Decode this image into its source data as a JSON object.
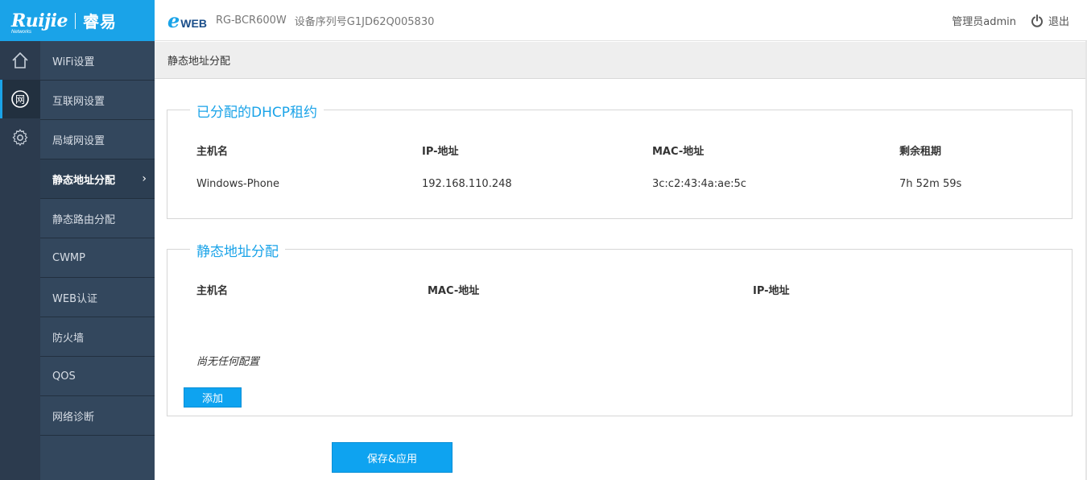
{
  "brand": {
    "logo_text": "Ruijie",
    "logo_sub": "Networks",
    "logo_cn": "睿易",
    "product_e": "e",
    "product_web": "WEB",
    "model": "RG-BCR600W",
    "serial": "设备序列号G1JD62Q005830"
  },
  "header": {
    "admin_label": "管理员admin",
    "logout_label": "退出"
  },
  "icons": [
    "home-icon",
    "network-icon",
    "gear-icon"
  ],
  "menu": {
    "items": [
      {
        "label": "WiFi设置"
      },
      {
        "label": "互联网设置"
      },
      {
        "label": "局域网设置"
      },
      {
        "label": "静态地址分配"
      },
      {
        "label": "静态路由分配"
      },
      {
        "label": "CWMP"
      },
      {
        "label": "WEB认证"
      },
      {
        "label": "防火墙"
      },
      {
        "label": "QOS"
      },
      {
        "label": "网络诊断"
      }
    ],
    "active_index": 3
  },
  "breadcrumb": "静态地址分配",
  "dhcp": {
    "legend": "已分配的DHCP租约",
    "headers": {
      "host": "主机名",
      "ip": "IP-地址",
      "mac": "MAC-地址",
      "lease": "剩余租期"
    },
    "rows": [
      {
        "host": "Windows-Phone",
        "ip": "192.168.110.248",
        "mac": "3c:c2:43:4a:ae:5c",
        "lease": "7h 52m 59s"
      }
    ]
  },
  "static": {
    "legend": "静态地址分配",
    "headers": {
      "host": "主机名",
      "mac": "MAC-地址",
      "ip": "IP-地址"
    },
    "empty_text": "尚无任何配置",
    "add_label": "添加"
  },
  "save_label": "保存&应用",
  "colors": {
    "accent": "#1aa3e8",
    "sidebar": "#33475d",
    "iconbar": "#2c3b4e"
  }
}
